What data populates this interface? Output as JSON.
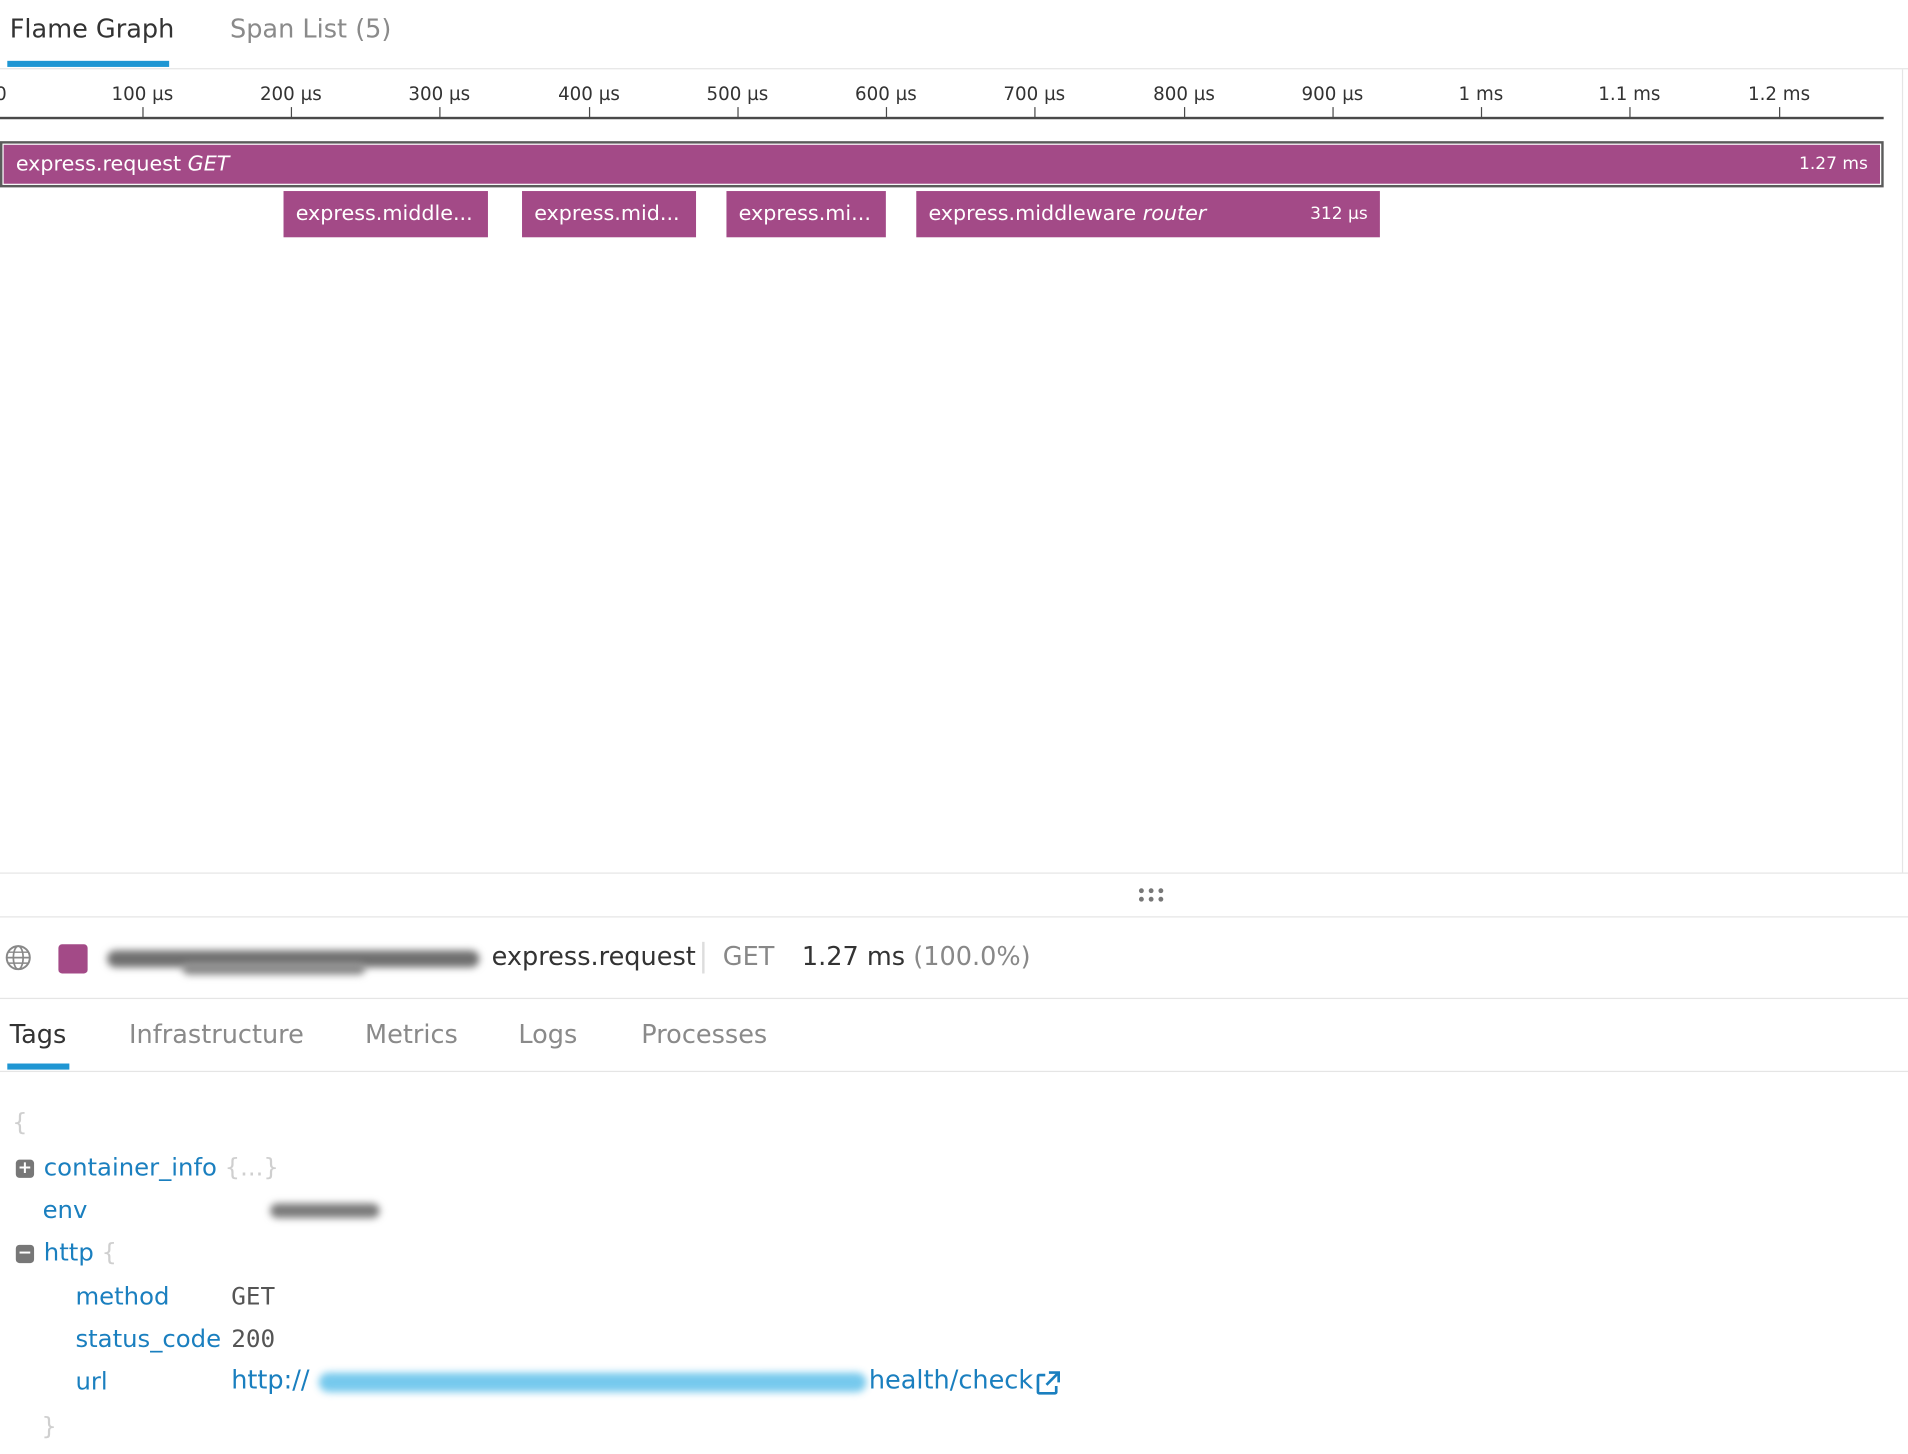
{
  "top_tabs": [
    {
      "label": "Flame Graph",
      "active": true
    },
    {
      "label": "Span List (5)",
      "active": false
    }
  ],
  "axis": {
    "ticks": [
      "0",
      "100 µs",
      "200 µs",
      "300 µs",
      "400 µs",
      "500 µs",
      "600 µs",
      "700 µs",
      "800 µs",
      "900 µs",
      "1 ms",
      "1.1 ms",
      "1.2 ms"
    ]
  },
  "spans": [
    {
      "name": "express.request",
      "resource": "GET",
      "duration": "1.27 ms",
      "color": "#a34a87"
    },
    {
      "name": "express.middle...",
      "resource": "",
      "duration": "",
      "color": "#a34a87"
    },
    {
      "name": "express.mid...",
      "resource": "",
      "duration": "",
      "color": "#a34a87"
    },
    {
      "name": "express.mi...",
      "resource": "",
      "duration": "",
      "color": "#a34a87"
    },
    {
      "name": "express.middleware",
      "resource": "router",
      "duration": "312 µs",
      "color": "#a34a87"
    }
  ],
  "selected_span": {
    "icon": "globe-icon",
    "color": "#a34a87",
    "name": "express.request",
    "method": "GET",
    "duration": "1.27 ms",
    "percent": "(100.0%)"
  },
  "detail_tabs": [
    {
      "label": "Tags",
      "active": true
    },
    {
      "label": "Infrastructure",
      "active": false
    },
    {
      "label": "Metrics",
      "active": false
    },
    {
      "label": "Logs",
      "active": false
    },
    {
      "label": "Processes",
      "active": false
    }
  ],
  "tags": {
    "open_brace": "{",
    "close_brace": "}",
    "container_info": {
      "key": "container_info",
      "collapsed_hint": "{...}",
      "toggle": "+"
    },
    "env": {
      "key": "env"
    },
    "http": {
      "key": "http",
      "open": "{",
      "toggle": "−",
      "method": {
        "key": "method",
        "value": "GET"
      },
      "status_code": {
        "key": "status_code",
        "value": "200"
      },
      "url": {
        "key": "url",
        "prefix": "http://",
        "suffix": "health/check"
      }
    }
  },
  "colors": {
    "accent": "#1f96d3",
    "span": "#a34a87",
    "key": "#1a7fbf"
  }
}
